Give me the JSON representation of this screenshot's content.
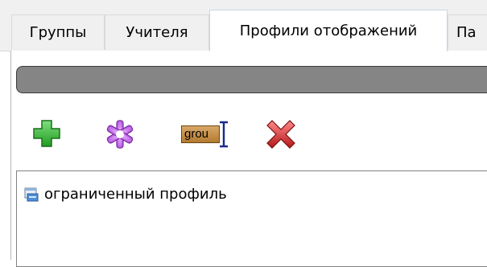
{
  "tabs": [
    {
      "label": "Группы",
      "active": false
    },
    {
      "label": "Учителя",
      "active": false
    },
    {
      "label": "Профили отображений",
      "active": true
    },
    {
      "label": "Па",
      "active": false
    }
  ],
  "toolbar": {
    "add_icon": "green-plus-icon",
    "edit_icon": "purple-asterisk-icon",
    "rename_icon": "rename-text-icon",
    "rename_text": "grou",
    "delete_icon": "red-x-icon"
  },
  "profiles": [
    {
      "label": "ограниченный профиль",
      "icon": "profile-icon"
    }
  ],
  "colors": {
    "add": "#2db82d",
    "edit": "#b04ee0",
    "delete": "#d42a2a",
    "graybar": "#858585"
  }
}
